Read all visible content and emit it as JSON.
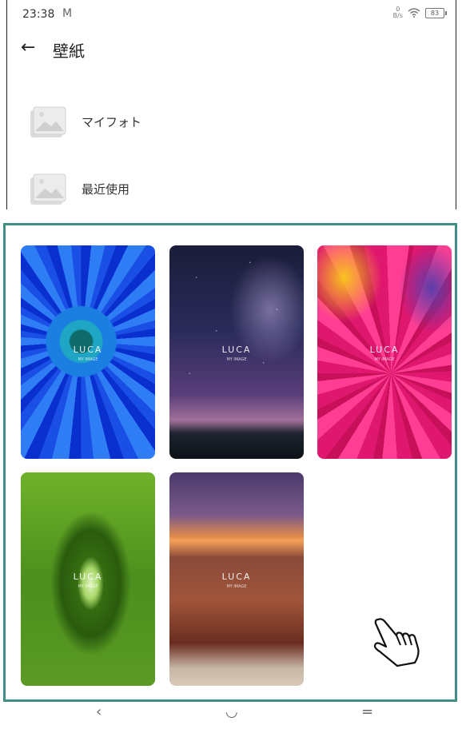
{
  "status": {
    "time": "23:38",
    "mail_icon": "gmail-icon",
    "net_speed_top": "0",
    "net_speed_unit": "B/s",
    "battery": "83"
  },
  "header": {
    "title": "壁紙",
    "back_icon": "arrow-left-icon"
  },
  "list": [
    {
      "label": "マイフォト",
      "icon": "image-placeholder-icon"
    },
    {
      "label": "最近使用",
      "icon": "image-placeholder-icon"
    }
  ],
  "wallpapers": [
    {
      "brand": "LUCA",
      "sub": "MY IMAGE",
      "theme": "blue-flower"
    },
    {
      "brand": "LUCA",
      "sub": "MY IMAGE",
      "theme": "starry-sky"
    },
    {
      "brand": "LUCA",
      "sub": "MY IMAGE",
      "theme": "pink-flower"
    },
    {
      "brand": "LUCA",
      "sub": "MY IMAGE",
      "theme": "green-tunnel"
    },
    {
      "brand": "LUCA",
      "sub": "MY IMAGE",
      "theme": "canyon-sunset"
    }
  ],
  "nav": {
    "back": "‹",
    "home": "◡",
    "menu": "="
  },
  "colors": {
    "highlight_border": "#3f8f86"
  }
}
